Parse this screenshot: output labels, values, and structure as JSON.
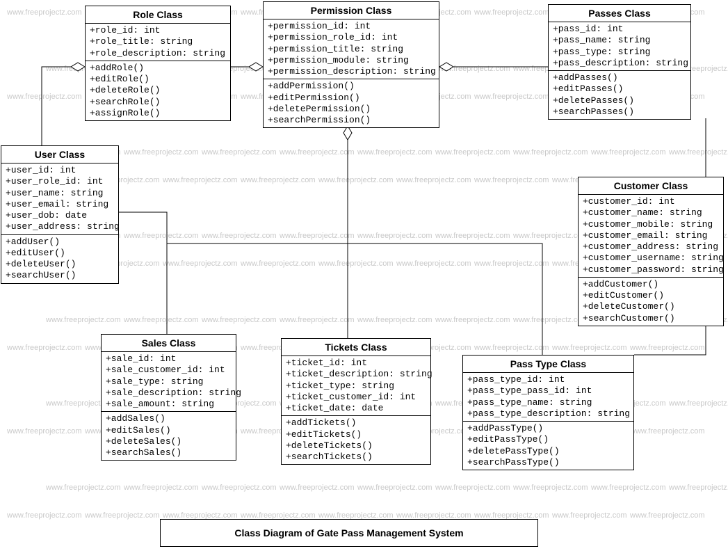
{
  "watermark_text": "www.freeprojectz.com",
  "diagram_title": "Class Diagram of Gate Pass Management System",
  "classes": {
    "role": {
      "title": "Role Class",
      "attrs": [
        "+role_id: int",
        "+role_title: string",
        "+role_description: string"
      ],
      "ops": [
        "+addRole()",
        "+editRole()",
        "+deleteRole()",
        "+searchRole()",
        "+assignRole()"
      ]
    },
    "permission": {
      "title": "Permission Class",
      "attrs": [
        "+permission_id: int",
        "+permission_role_id: int",
        "+permission_title: string",
        "+permission_module: string",
        "+permission_description: string"
      ],
      "ops": [
        "+addPermission()",
        "+editPermission()",
        "+deletePermission()",
        "+searchPermission()"
      ]
    },
    "passes": {
      "title": "Passes Class",
      "attrs": [
        "+pass_id: int",
        "+pass_name: string",
        "+pass_type: string",
        "+pass_description: string"
      ],
      "ops": [
        "+addPasses()",
        "+editPasses()",
        "+deletePasses()",
        "+searchPasses()"
      ]
    },
    "user": {
      "title": "User Class",
      "attrs": [
        "+user_id: int",
        "+user_role_id: int",
        "+user_name: string",
        "+user_email: string",
        "+user_dob: date",
        "+user_address: string"
      ],
      "ops": [
        "+addUser()",
        "+editUser()",
        "+deleteUser()",
        "+searchUser()"
      ]
    },
    "customer": {
      "title": "Customer Class",
      "attrs": [
        "+customer_id: int",
        "+customer_name: string",
        "+customer_mobile: string",
        "+customer_email: string",
        "+customer_address: string",
        "+customer_username: string",
        "+customer_password: string"
      ],
      "ops": [
        "+addCustomer()",
        "+editCustomer()",
        "+deleteCustomer()",
        "+searchCustomer()"
      ]
    },
    "sales": {
      "title": "Sales Class",
      "attrs": [
        "+sale_id: int",
        "+sale_customer_id: int",
        "+sale_type: string",
        "+sale_description: string",
        "+sale_amount: string"
      ],
      "ops": [
        "+addSales()",
        "+editSales()",
        "+deleteSales()",
        "+searchSales()"
      ]
    },
    "tickets": {
      "title": "Tickets Class",
      "attrs": [
        "+ticket_id: int",
        "+ticket_description: string",
        "+ticket_type: string",
        "+ticket_customer_id: int",
        "+ticket_date: date"
      ],
      "ops": [
        "+addTickets()",
        "+editTickets()",
        "+deleteTickets()",
        "+searchTickets()"
      ]
    },
    "passtype": {
      "title": "Pass Type Class",
      "attrs": [
        "+pass_type_id: int",
        "+pass_type_pass_id: int",
        "+pass_type_name: string",
        "+pass_type_description: string"
      ],
      "ops": [
        "+addPassType()",
        "+editPassType()",
        "+deletePassType()",
        "+searchPassType()"
      ]
    }
  }
}
